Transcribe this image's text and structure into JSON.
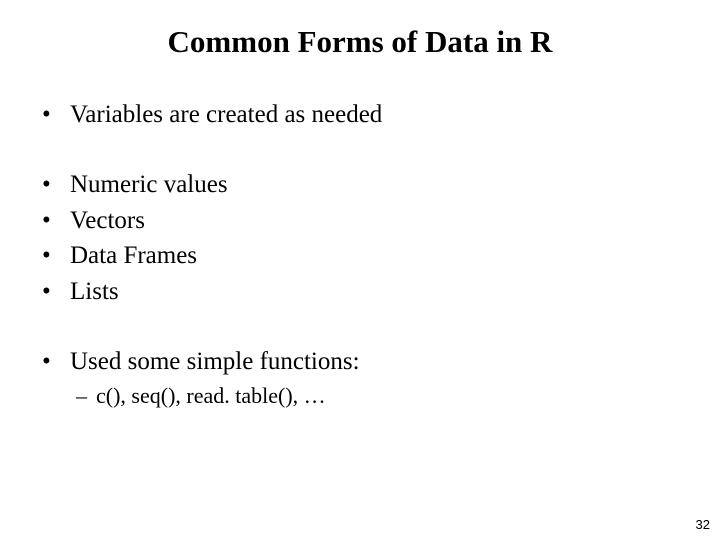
{
  "title": "Common Forms of Data in R",
  "group1": {
    "items": [
      "Variables are created as needed"
    ]
  },
  "group2": {
    "items": [
      "Numeric values",
      "Vectors",
      "Data Frames",
      "Lists"
    ]
  },
  "group3": {
    "items": [
      "Used some simple functions:"
    ],
    "sub": [
      "c(), seq(), read. table(), …"
    ]
  },
  "page_number": "32",
  "bullet_char": "•",
  "dash_char": "–"
}
